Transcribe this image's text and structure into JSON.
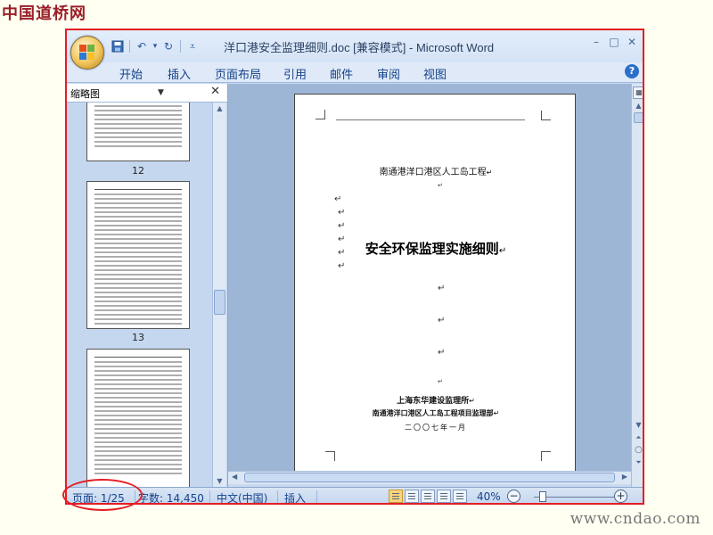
{
  "watermark": {
    "site_logo": "中国道桥网",
    "site_url": "www.cndao.com"
  },
  "window": {
    "title": "洋口港安全监理细则.doc [兼容模式] - Microsoft Word",
    "controls": {
      "minimize": "–",
      "restore": "□",
      "close": "✕"
    }
  },
  "quick_access": {
    "icons": [
      "save-icon",
      "undo-icon",
      "redo-icon",
      "customize-icon"
    ],
    "glyphs": {
      "save": "💾",
      "undo": "↶",
      "dropdown": "▾",
      "redo": "↻",
      "customize": "⩡"
    }
  },
  "ribbon": {
    "tabs": [
      "开始",
      "插入",
      "页面布局",
      "引用",
      "邮件",
      "审阅",
      "视图"
    ],
    "help": "?"
  },
  "nav_pane": {
    "view_label": "缩略图",
    "thumbnails": [
      {
        "page_number": "12"
      },
      {
        "page_number": "13"
      }
    ]
  },
  "document": {
    "project_line": "南通港洋口港区人工岛工程",
    "paragraph_mark": "↵",
    "main_title": "安全环保监理实施细则",
    "org_line": "上海东华建设监理所",
    "dept_line": "南通港洋口港区人工岛工程项目监理部",
    "date_line": "二〇〇七年一月"
  },
  "status_bar": {
    "page_indicator": "页面: 1/25",
    "word_count": "字数: 14,450",
    "language": "中文(中国)",
    "insert_mode": "插入",
    "zoom_level": "40%",
    "zoom_out": "−",
    "zoom_in": "+",
    "zoom_fraction": 0.4
  },
  "annotation": {
    "color": "#e41d23"
  }
}
